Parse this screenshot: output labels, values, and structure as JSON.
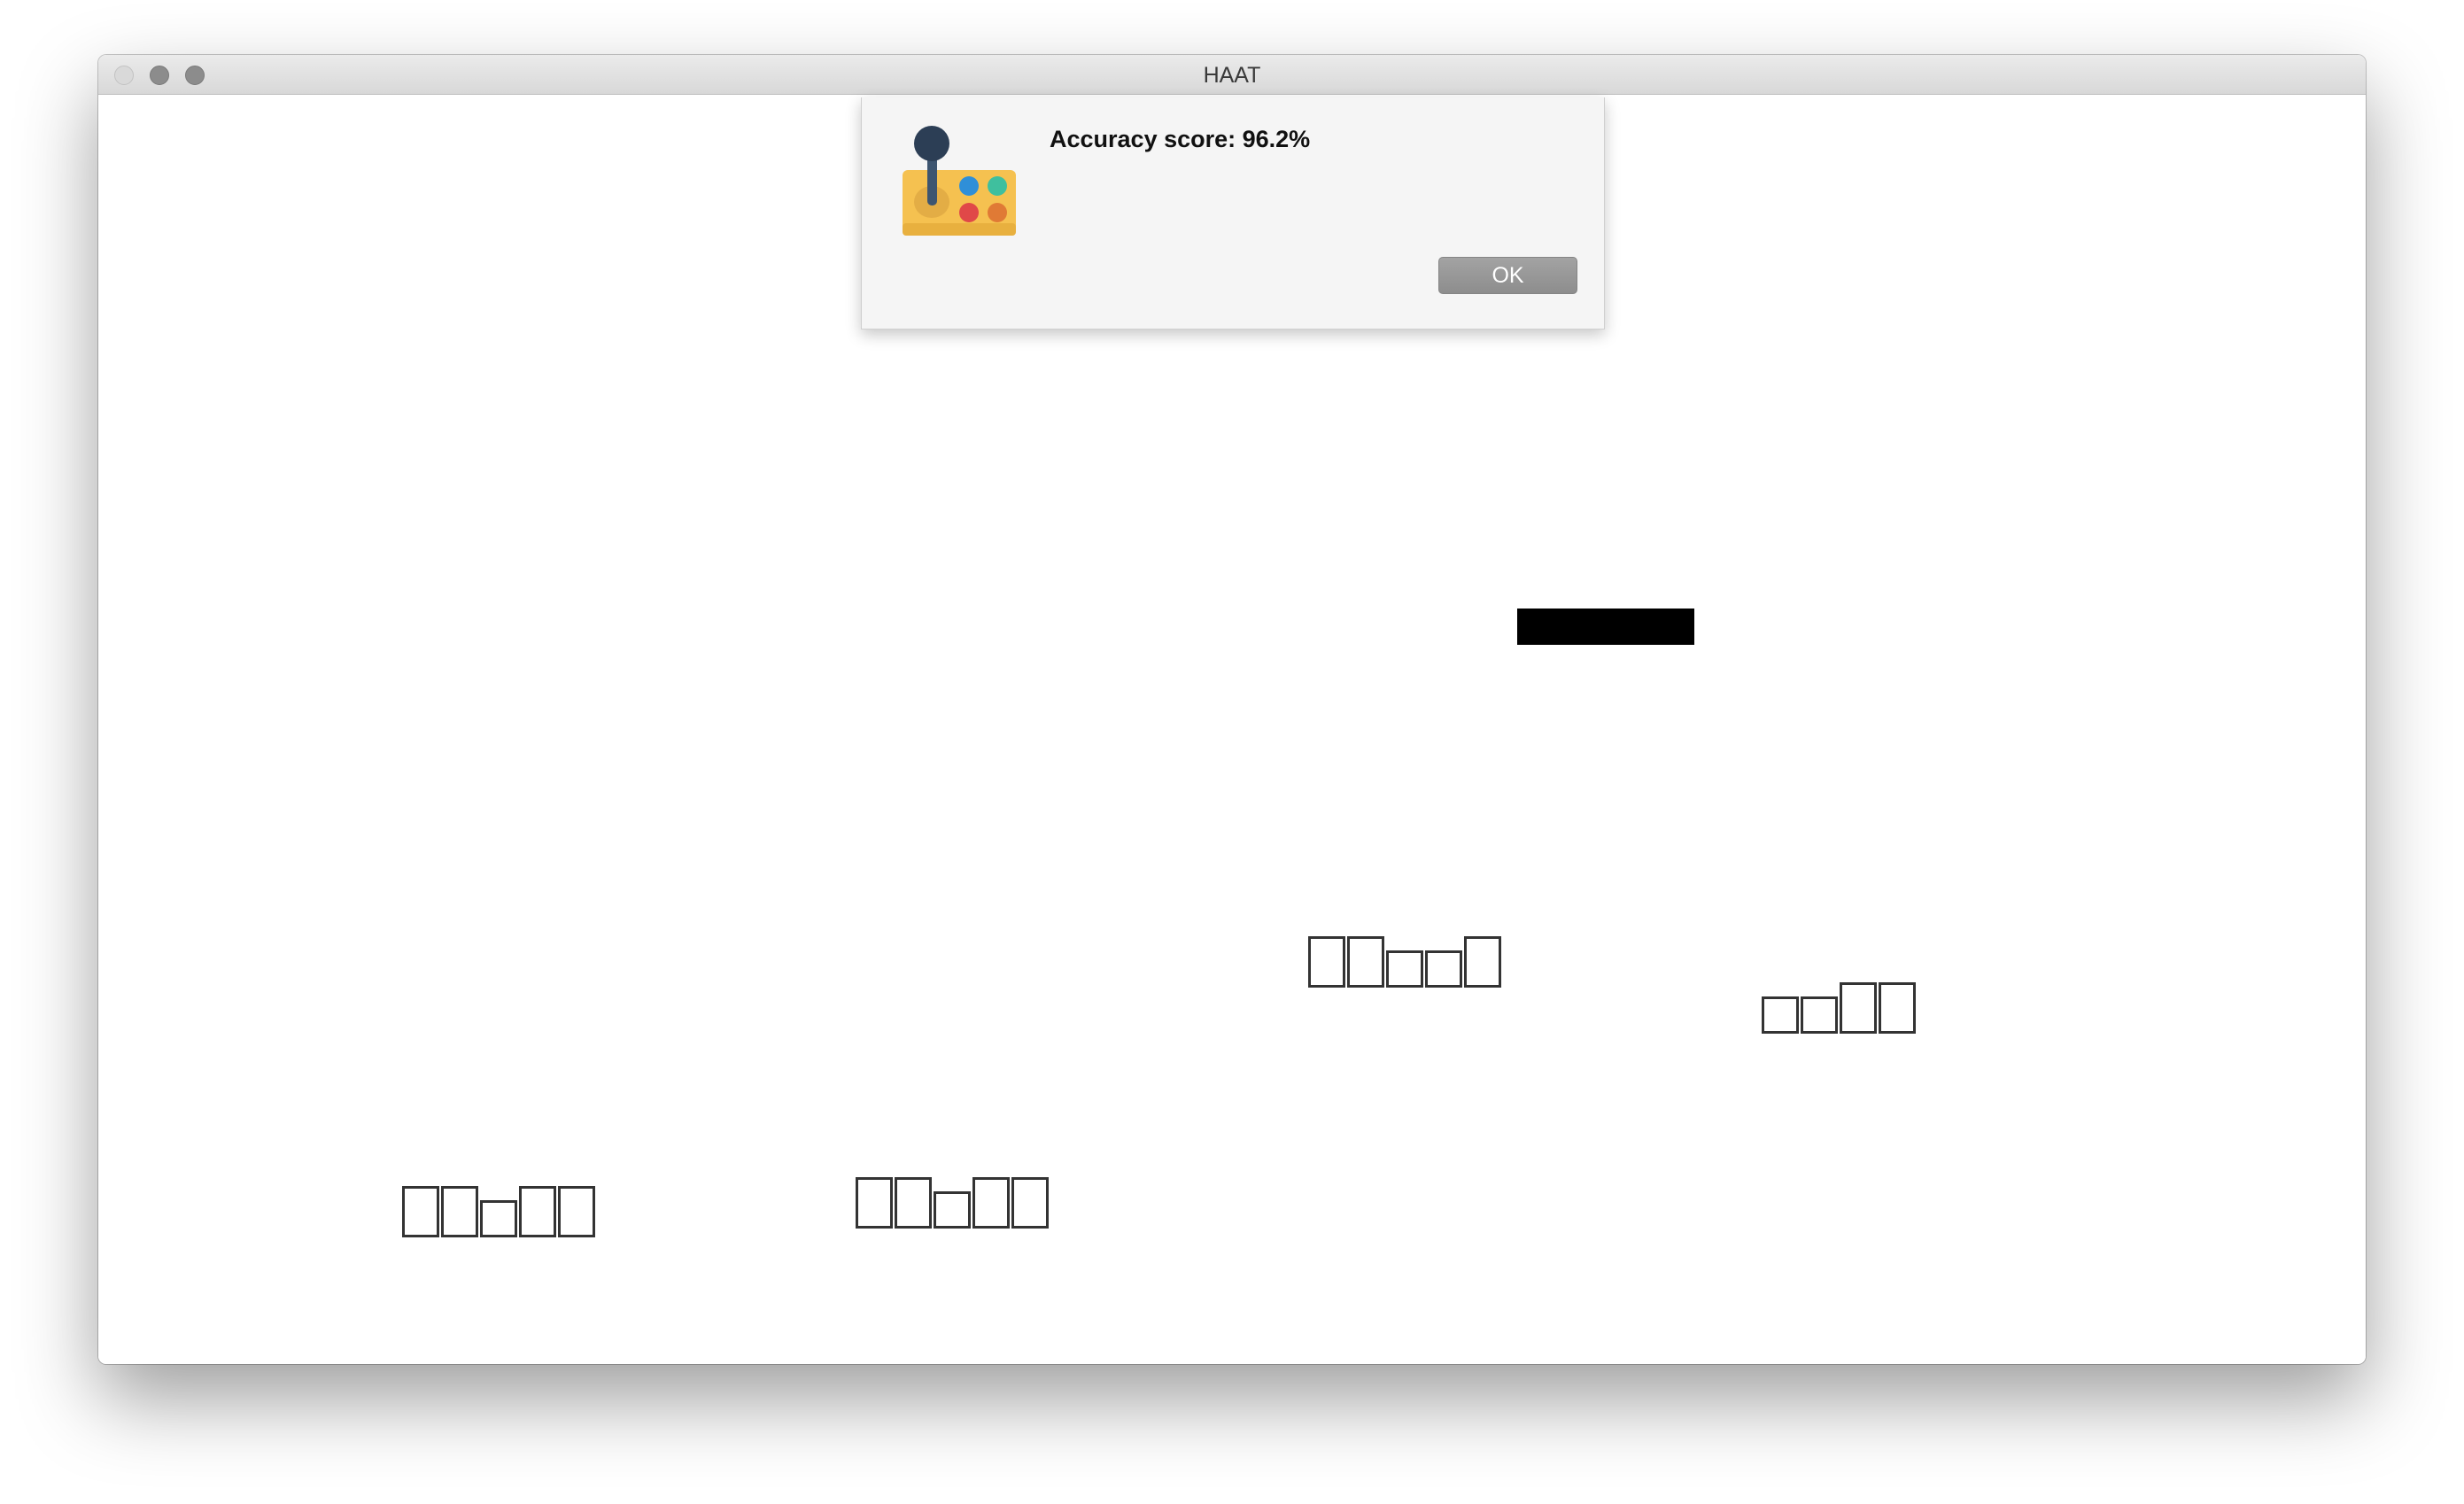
{
  "window": {
    "title": "HAAT"
  },
  "alert": {
    "icon": "arcade-joystick-icon",
    "message": "Accuracy score: 96.2%",
    "ok_label": "OK"
  },
  "game": {
    "paddle_color": "#000000",
    "block_border_color": "#333333",
    "block_groups": [
      {
        "name": "block-group-1",
        "pattern": [
          "tall",
          "tall",
          "short",
          "short",
          "tall"
        ]
      },
      {
        "name": "block-group-2",
        "pattern": [
          "short",
          "short",
          "tall",
          "tall"
        ]
      },
      {
        "name": "block-group-3",
        "pattern": [
          "tall",
          "tall",
          "short",
          "tall",
          "tall"
        ]
      },
      {
        "name": "block-group-4",
        "pattern": [
          "tall",
          "tall",
          "short",
          "tall",
          "tall"
        ]
      }
    ]
  }
}
